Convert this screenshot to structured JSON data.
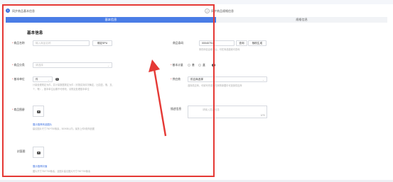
{
  "topbar": {
    "notice": ""
  },
  "steps": [
    {
      "number": "1",
      "label": "同步商品基本信息"
    },
    {
      "number": "2",
      "label": "同步商品规格信息"
    }
  ],
  "tabs": {
    "active": "基本信息",
    "inactive": "规格信息"
  },
  "section": {
    "title": "基本信息"
  },
  "fields": {
    "product_name": {
      "label": "商品名称",
      "placeholder": "输入商品名称",
      "button": "绑定SPU"
    },
    "product_code": {
      "label": "商品条码",
      "value": "00040751",
      "query_button": "查询",
      "random_button": "随机生成",
      "hint": "条形码信息填写后，可在商品搜索可查询"
    },
    "category": {
      "label": "商品分类",
      "placeholder": "请选择"
    },
    "unit_count": {
      "label": "基本计量",
      "opt1": "套",
      "opt2": "盒"
    },
    "base_unit": {
      "label": "基本单位",
      "value": "件",
      "hint1": "计量处理规定为件，并计量数据规定为件（可按实际情况确定，比如盒、瓶、支、个、等），基本单位后期不可修改，请规定处理基本单位",
      "hint2": ""
    },
    "supplier": {
      "label": "供应商",
      "value": "供应商选择",
      "hint": "选择供应商，可填写完成后在采购单据中可选择供应商"
    },
    "images": {
      "label": "商品图册",
      "link": "展示推荐商品图片",
      "hint": "建议图片尺寸750*750像素，500KB以内，最多上传5张商品图"
    },
    "description": {
      "label": "描述信息",
      "placeholder": "请输入描述信息",
      "counter": "0/70"
    },
    "cover": {
      "label": "封面图",
      "link": "展示推荐封面",
      "hint": "图片尺寸750*750像素，且图片建议图片尺寸750*750像素"
    }
  },
  "colors": {
    "accent": "#4a7de6",
    "highlight": "#e53935"
  },
  "icons": {
    "camera": "camera-icon",
    "help": "help-icon",
    "chevron": "chevron-down-icon"
  }
}
